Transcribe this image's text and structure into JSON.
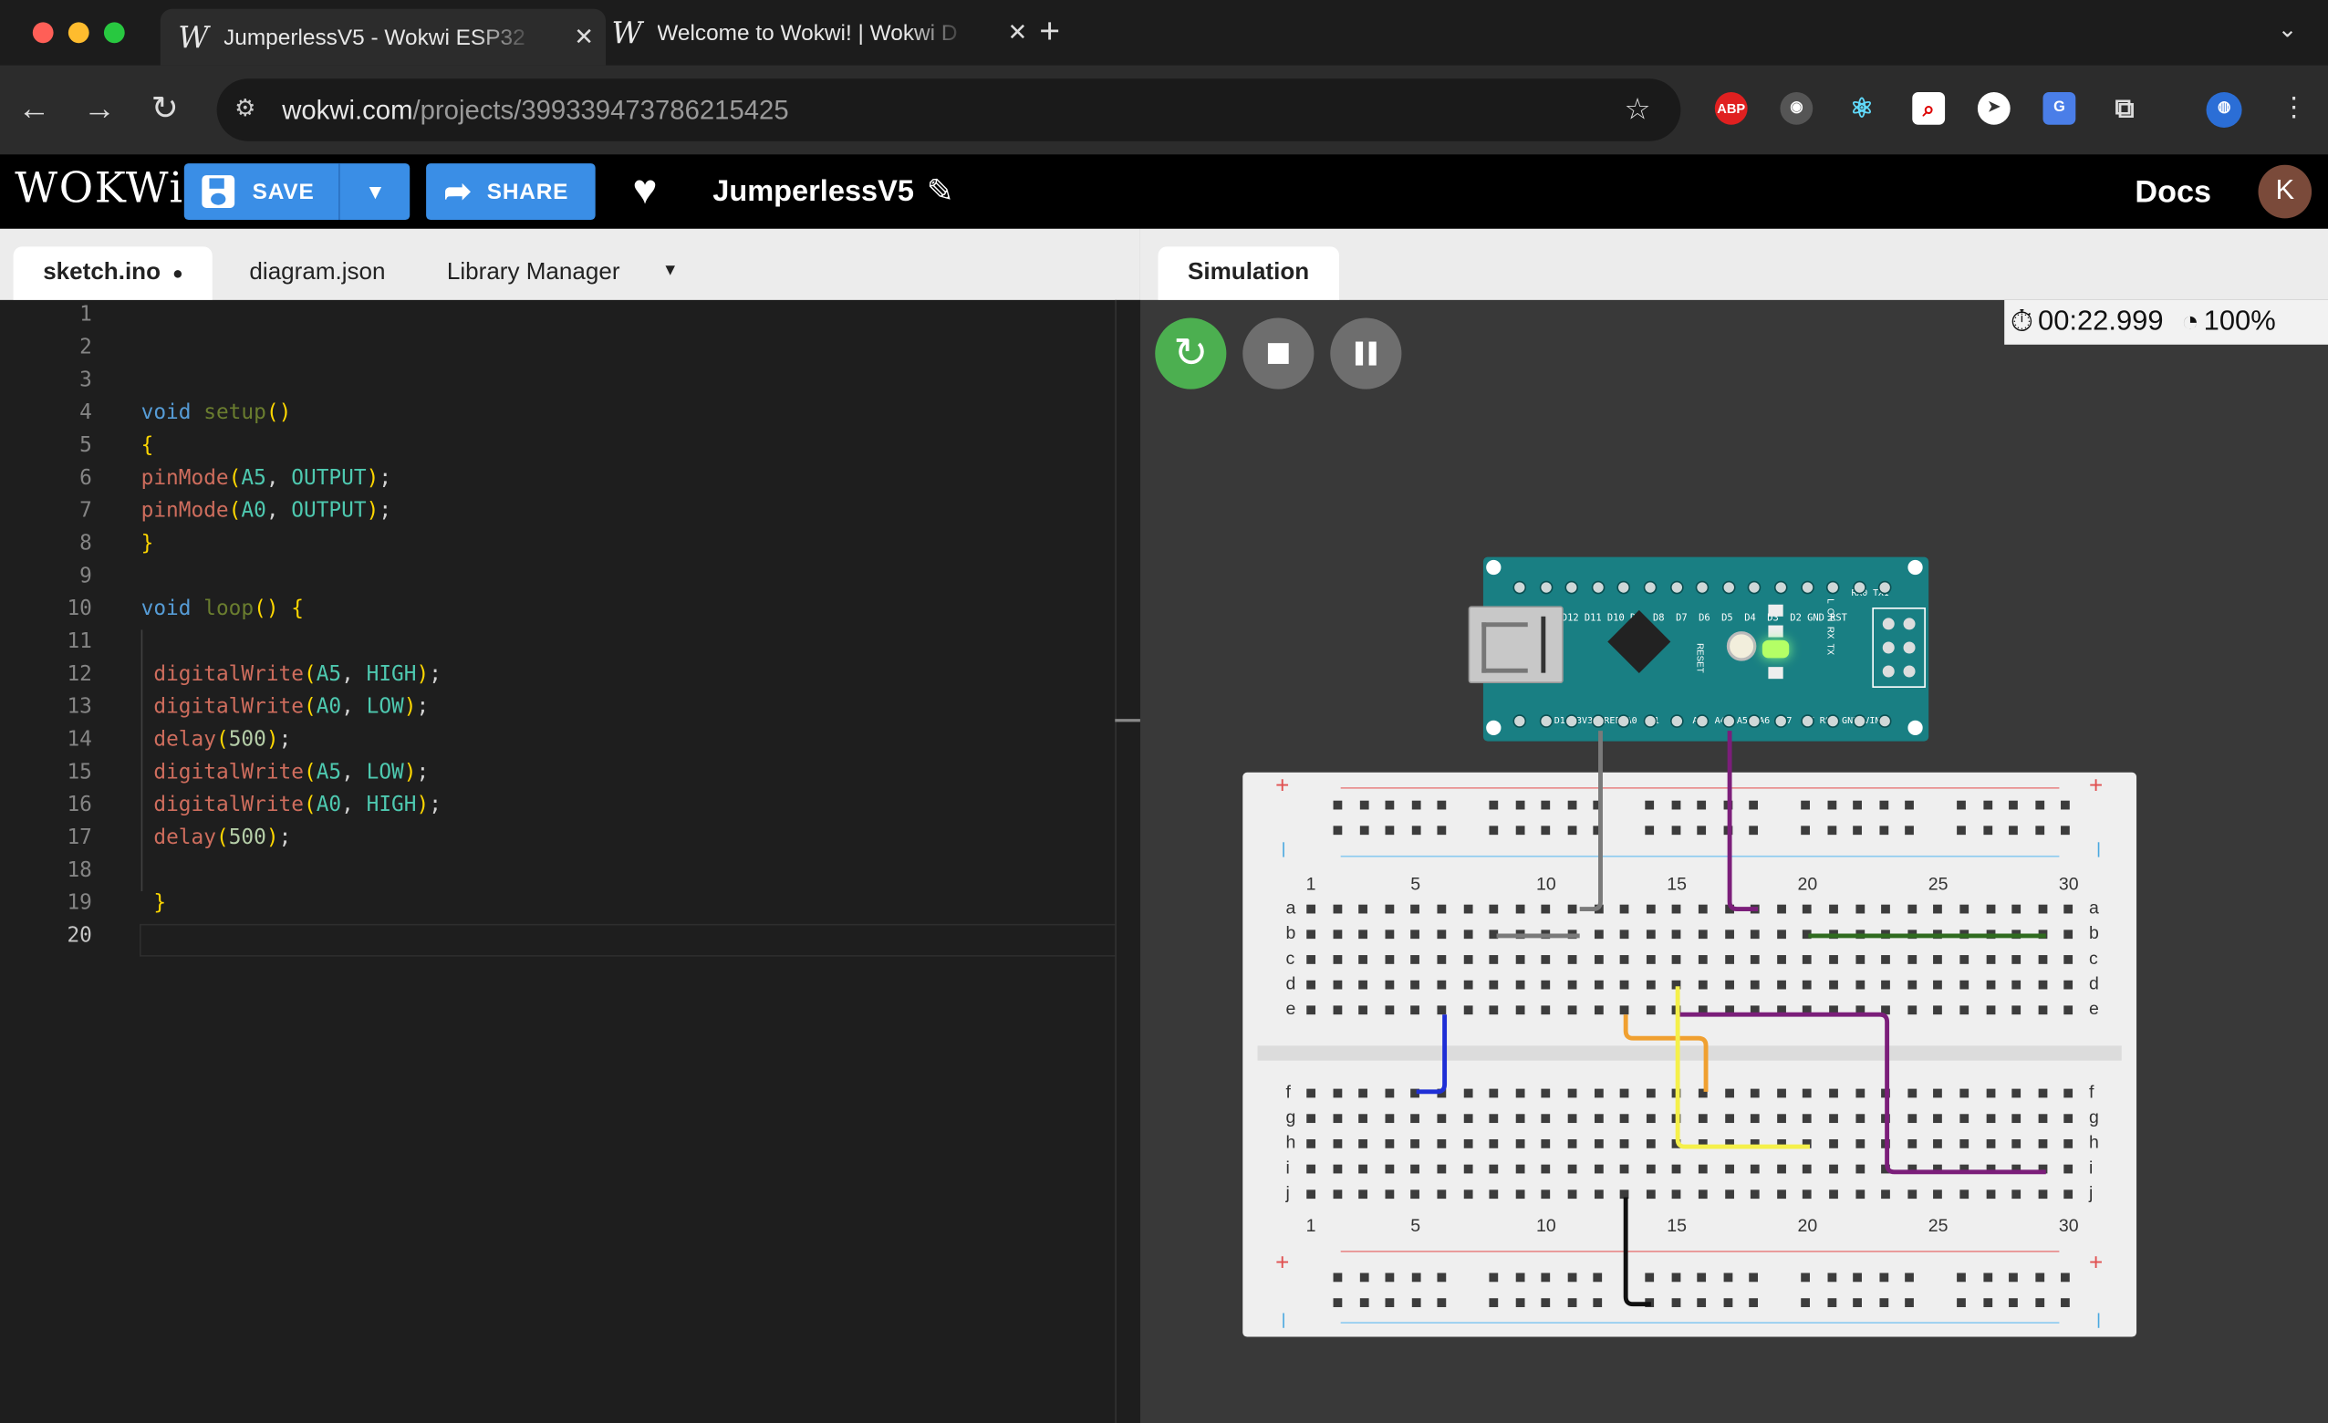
{
  "browser": {
    "tabs": [
      {
        "title": "JumperlessV5 - Wokwi ESP32",
        "active": true
      },
      {
        "title": "Welcome to Wokwi! | Wokwi D",
        "active": false
      }
    ],
    "new_tab": "+",
    "url_host": "wokwi.com",
    "url_path": "/projects/399339473786215425",
    "extensions": [
      "ABP",
      "spy-glasses-icon",
      "react-icon",
      "search-ext-icon",
      "cursor-ext-icon",
      "translate-icon",
      "puzzle-icon",
      "profile-globe-icon"
    ]
  },
  "wokwi": {
    "logo": "WOKWi",
    "save_label": "SAVE",
    "share_label": "SHARE",
    "project_name": "JumperlessV5",
    "docs_label": "Docs",
    "avatar_letter": "K",
    "accent": "#3a8ee6"
  },
  "editor": {
    "tabs": [
      "sketch.ino",
      "diagram.json",
      "Library Manager"
    ],
    "active_tab": "sketch.ino",
    "unsaved_marker": "●",
    "lines": [
      "",
      "",
      "",
      "void setup()",
      "{",
      "pinMode(A5, OUTPUT);",
      "pinMode(A0, OUTPUT);",
      "}",
      "",
      "void loop() {",
      "",
      " digitalWrite(A5, HIGH);",
      " digitalWrite(A0, LOW);",
      " delay(500);",
      " digitalWrite(A5, LOW);",
      " digitalWrite(A0, HIGH);",
      " delay(500);",
      "",
      " }",
      ""
    ]
  },
  "simulation": {
    "tab": "Simulation",
    "timer": "00:22.999",
    "speed": "100%",
    "board": {
      "top_pins": "D12 D11 D10 D9  D8  D7  D6  D5  D4  D3  D2 GND RST",
      "top_right": "RX0 TX1",
      "bottom_pins": "D13 3V3 AREF A0  A1  A2  A3  A4  A5  A6  A7  5V RST GND VIN",
      "reset_label": "RESET",
      "led_labels": "L  ON  RX  TX"
    },
    "breadboard": {
      "column_numbers": [
        "1",
        "5",
        "10",
        "15",
        "20",
        "25",
        "30"
      ],
      "rows_top": [
        "a",
        "b",
        "c",
        "d",
        "e"
      ],
      "rows_bottom": [
        "f",
        "g",
        "h",
        "i",
        "j"
      ],
      "plus": "+",
      "minus": "-"
    },
    "wire_colors": {
      "gray": "#7a7a7a",
      "purple": "#7b1e7a",
      "green": "#2f6b1f",
      "blue": "#1f2fd6",
      "orange": "#f0a030",
      "yellow": "#f5f04a",
      "black": "#111111"
    }
  }
}
